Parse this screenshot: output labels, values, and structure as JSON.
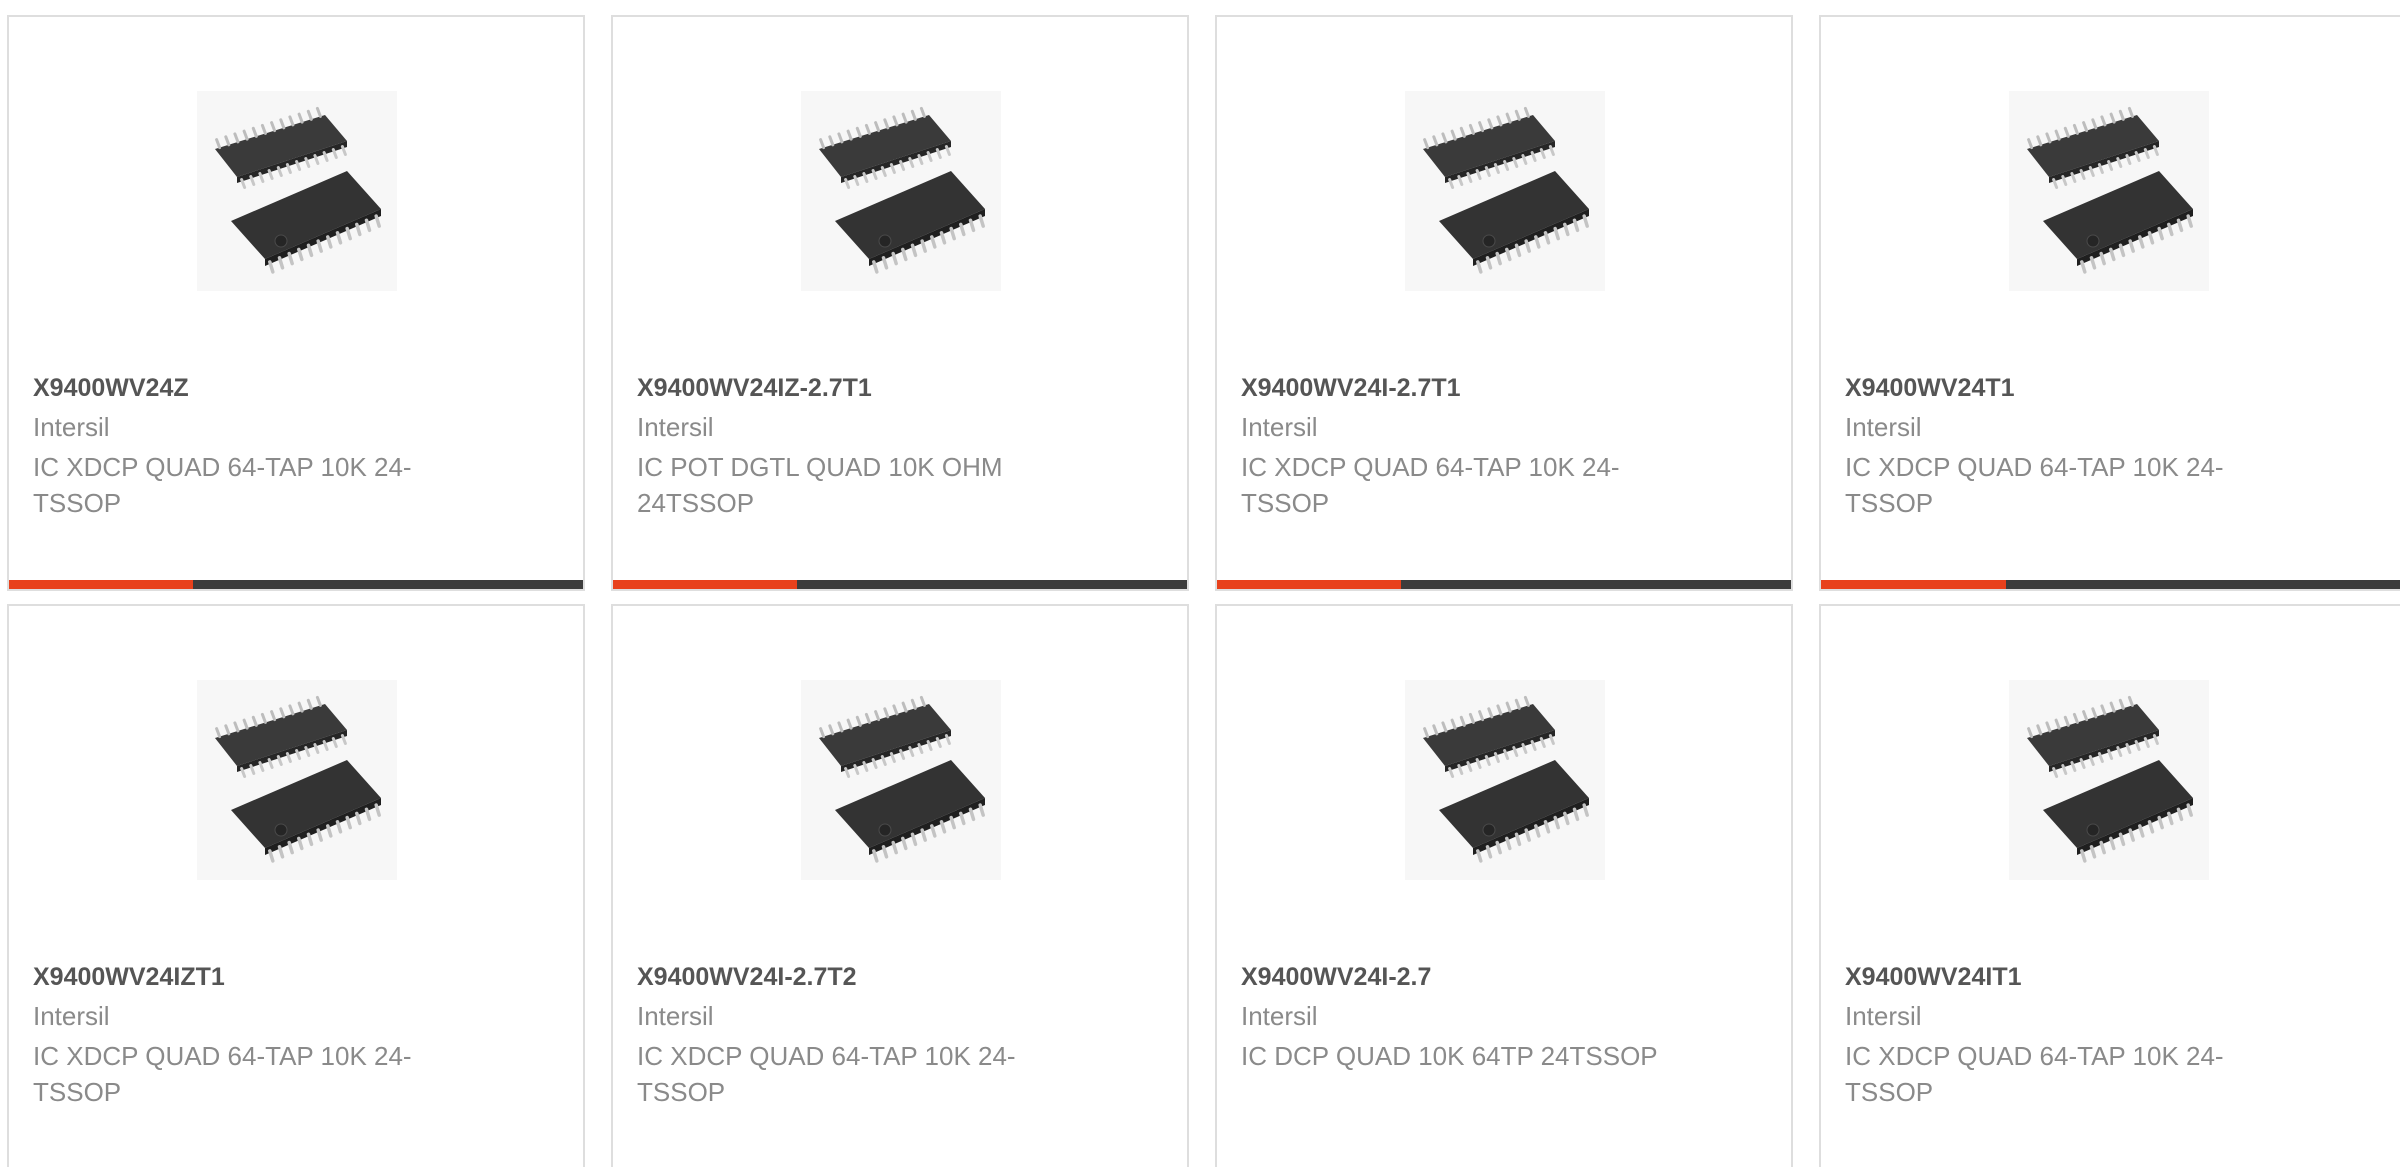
{
  "accent_color": "#e8411c",
  "bar_color": "#3c3c3c",
  "image_icon": "tssop-24-chip-package",
  "products": [
    {
      "part": "X9400WV24Z",
      "maker": "Intersil",
      "desc": "IC XDCP QUAD 64-TAP 10K 24-TSSOP",
      "progress": 0.32
    },
    {
      "part": "X9400WV24IZ-2.7T1",
      "maker": "Intersil",
      "desc": "IC POT DGTL QUAD 10K OHM 24TSSOP",
      "progress": 0.32
    },
    {
      "part": "X9400WV24I-2.7T1",
      "maker": "Intersil",
      "desc": "IC XDCP QUAD 64-TAP 10K 24-TSSOP",
      "progress": 0.32
    },
    {
      "part": "X9400WV24T1",
      "maker": "Intersil",
      "desc": "IC XDCP QUAD 64-TAP 10K 24-TSSOP",
      "progress": 0.32
    },
    {
      "part": "X9400WV24IZT1",
      "maker": "Intersil",
      "desc": "IC XDCP QUAD 64-TAP 10K 24-TSSOP",
      "progress": null
    },
    {
      "part": "X9400WV24I-2.7T2",
      "maker": "Intersil",
      "desc": "IC XDCP QUAD 64-TAP 10K 24-TSSOP",
      "progress": null
    },
    {
      "part": "X9400WV24I-2.7",
      "maker": "Intersil",
      "desc": "IC DCP QUAD 10K 64TP 24TSSOP",
      "progress": null
    },
    {
      "part": "X9400WV24IT1",
      "maker": "Intersil",
      "desc": "IC XDCP QUAD 64-TAP 10K 24-TSSOP",
      "progress": null
    }
  ]
}
